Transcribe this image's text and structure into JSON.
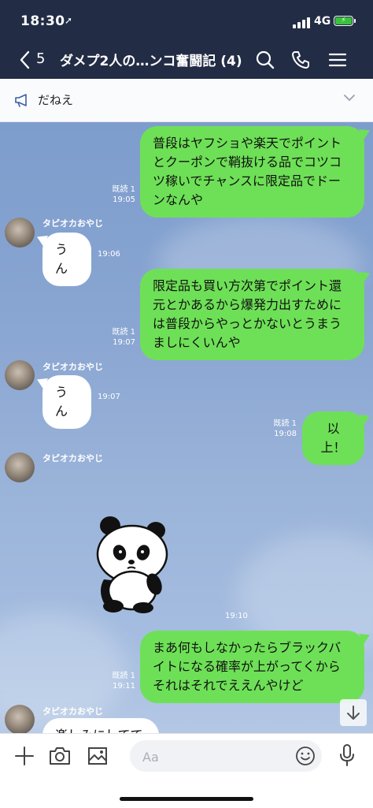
{
  "status_bar": {
    "time": "18:30",
    "location_arrow": "➚",
    "network": "4G",
    "battery_state": "charging"
  },
  "header": {
    "back_count": "5",
    "title": "ダメプ2人の…ンコ奮闘記 (4)",
    "icons": [
      "search-icon",
      "phone-icon",
      "menu-icon"
    ]
  },
  "announcement": {
    "text": "だねえ"
  },
  "messages": [
    {
      "side": "mine",
      "text": "普段はヤフショや楽天でポイントとクーポンで鞘抜ける品でコツコツ稼いでチャンスに限定品でドーンなんや",
      "read": "既読 1",
      "time": "19:05"
    },
    {
      "side": "theirs",
      "sender": "タピオカおやじ",
      "text": "うん",
      "time": "19:06"
    },
    {
      "side": "mine",
      "text": "限定品も買い方次第でポイント還元とかあるから爆発力出すためには普段からやっとかないとうまうましにくいんや",
      "read": "既読 1",
      "time": "19:07"
    },
    {
      "side": "theirs",
      "sender": "タピオカおやじ",
      "text": "うん",
      "time": "19:07"
    },
    {
      "side": "mine",
      "text": "以上！",
      "read": "既読 1",
      "time": "19:08"
    },
    {
      "side": "theirs",
      "sender": "タピオカおやじ",
      "sticker": "panda-sticker",
      "time": "19:10"
    },
    {
      "side": "mine",
      "text": "まあ何もしなかったらブラックバイトになる確率が上がってくからそれはそれでええんやけど",
      "read": "既読 1",
      "time": "19:11"
    },
    {
      "side": "theirs",
      "sender": "タピオカおやじ",
      "text": "楽しみにしてて"
    }
  ],
  "input_bar": {
    "placeholder": "Aa",
    "icons": [
      "plus-icon",
      "camera-icon",
      "image-icon",
      "emoji-icon",
      "microphone-icon"
    ]
  },
  "colors": {
    "header_bg": "#222c45",
    "my_bubble": "#6ee057",
    "their_bubble": "#ffffff",
    "chat_bg": "#8aa6d2"
  }
}
